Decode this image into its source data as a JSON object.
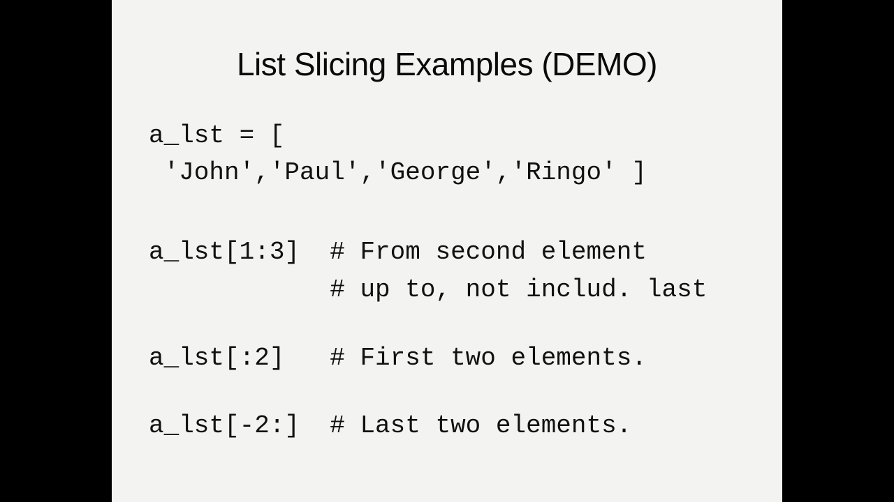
{
  "slide": {
    "title": "List Slicing Examples (DEMO)",
    "code": {
      "assign_line1": "a_lst = [",
      "assign_line2": " 'John','Paul','George','Ringo' ]",
      "ex1_code": "a_lst[1:3]  ",
      "ex1_comment_1": "# From second element",
      "ex1_comment_2_indent": "            ",
      "ex1_comment_2": "# up to, not includ. last",
      "ex2_code": "a_lst[:2]   ",
      "ex2_comment": "# First two elements.",
      "ex3_code": "a_lst[-2:]  ",
      "ex3_comment": "# Last two elements."
    }
  }
}
